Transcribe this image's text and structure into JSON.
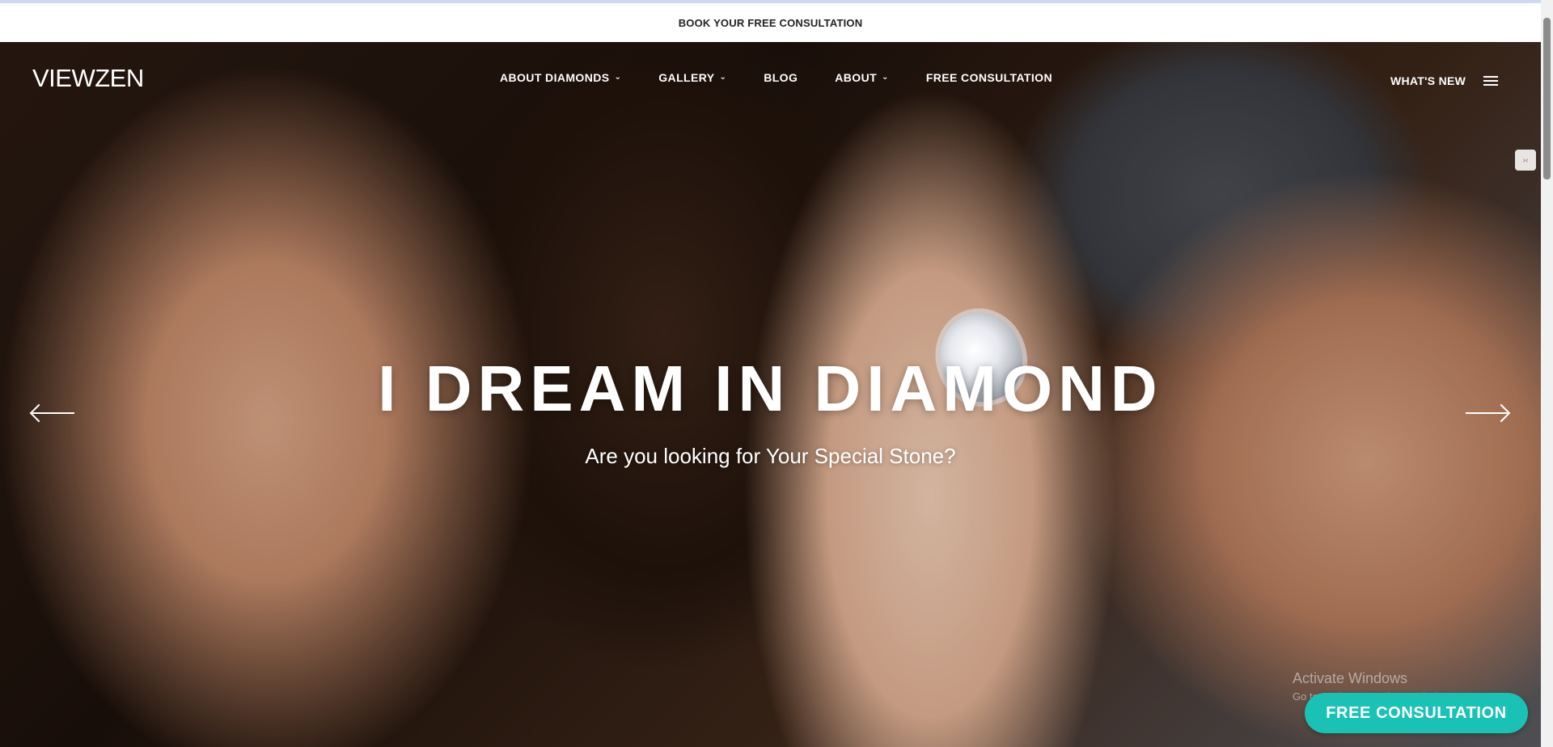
{
  "announcement": {
    "label": "BOOK YOUR FREE CONSULTATION"
  },
  "brand": {
    "logo_text": "VIEWZEN"
  },
  "nav": {
    "items": [
      {
        "label": "ABOUT DIAMONDS",
        "has_dropdown": true
      },
      {
        "label": "GALLERY",
        "has_dropdown": true
      },
      {
        "label": "BLOG",
        "has_dropdown": false
      },
      {
        "label": "ABOUT",
        "has_dropdown": true
      },
      {
        "label": "FREE CONSULTATION",
        "has_dropdown": false
      }
    ],
    "whats_new": "WHAT'S NEW",
    "menu_icon": "hamburger-icon"
  },
  "hero": {
    "headline": "I DREAM IN DIAMOND",
    "subheadline": "Are you looking for Your Special Stone?",
    "prev_icon": "arrow-left-icon",
    "next_icon": "arrow-right-icon"
  },
  "side_widget": {
    "icon": "chat-widget-icon"
  },
  "watermark": {
    "title": "Activate Windows",
    "subtitle": "Go to Settings to activate Windows."
  },
  "cta": {
    "label": "FREE CONSULTATION"
  },
  "colors": {
    "accent": "#19c2b4",
    "announce_text": "#222222"
  }
}
